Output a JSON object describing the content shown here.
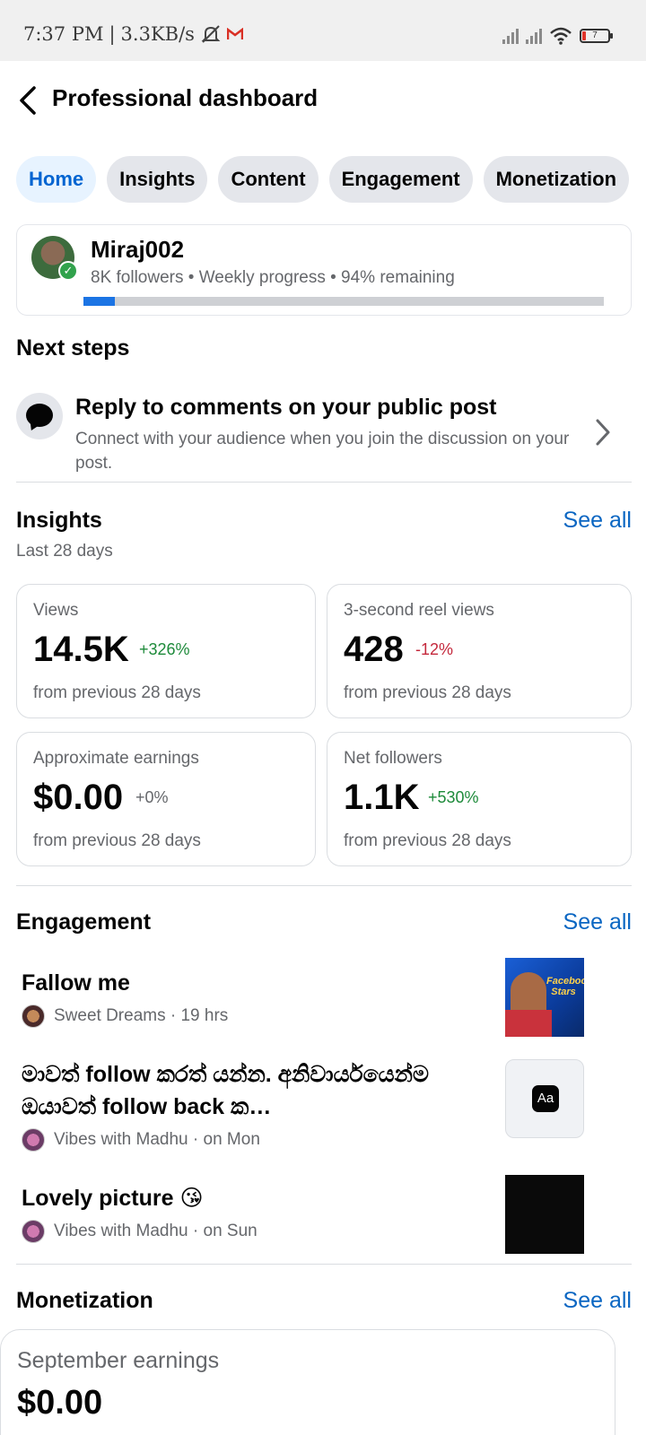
{
  "status_bar": {
    "time": "7:37 PM",
    "separator": "|",
    "speed": "3.3KB/s",
    "battery": "7"
  },
  "header": {
    "title": "Professional dashboard"
  },
  "tabs": [
    {
      "label": "Home",
      "active": true
    },
    {
      "label": "Insights",
      "active": false
    },
    {
      "label": "Content",
      "active": false
    },
    {
      "label": "Engagement",
      "active": false
    },
    {
      "label": "Monetization",
      "active": false
    }
  ],
  "profile": {
    "name": "Miraj002",
    "meta": "8K followers • Weekly progress • 94% remaining",
    "progress_fraction": 0.06
  },
  "next_steps": {
    "heading": "Next steps",
    "title": "Reply to comments on your public post",
    "description": "Connect with your audience when you join the discussion on your post."
  },
  "insights": {
    "heading": "Insights",
    "see_all": "See all",
    "period": "Last 28 days",
    "cards": [
      {
        "label": "Views",
        "value": "14.5K",
        "change": "+326%",
        "footer": "from previous 28 days"
      },
      {
        "label": "3-second reel views",
        "value": "428",
        "change": "-12%",
        "footer": "from previous 28 days"
      },
      {
        "label": "Approximate earnings",
        "value": "$0.00",
        "change": "+0%",
        "footer": "from previous 28 days"
      },
      {
        "label": "Net followers",
        "value": "1.1K",
        "change": "+530%",
        "footer": "from previous 28 days"
      }
    ]
  },
  "engagement": {
    "heading": "Engagement",
    "see_all": "See all",
    "items": [
      {
        "title": "Fallow me",
        "meta": "Sweet Dreams · 19 hrs"
      },
      {
        "title": "මාවත් follow කරත් යන්න. අනිවාර්යයෙන්ම ඔයාවත් follow back ක…",
        "meta": "Vibes with Madhu · on Mon",
        "thumb_text": "Aa"
      },
      {
        "title": "Lovely picture 😘",
        "meta": "Vibes with Madhu · on Sun"
      }
    ],
    "thumb_photo_text": "Facebook Stars"
  },
  "monetization": {
    "heading": "Monetization",
    "see_all": "See all",
    "card_label": "September earnings",
    "card_value": "$0.00"
  }
}
